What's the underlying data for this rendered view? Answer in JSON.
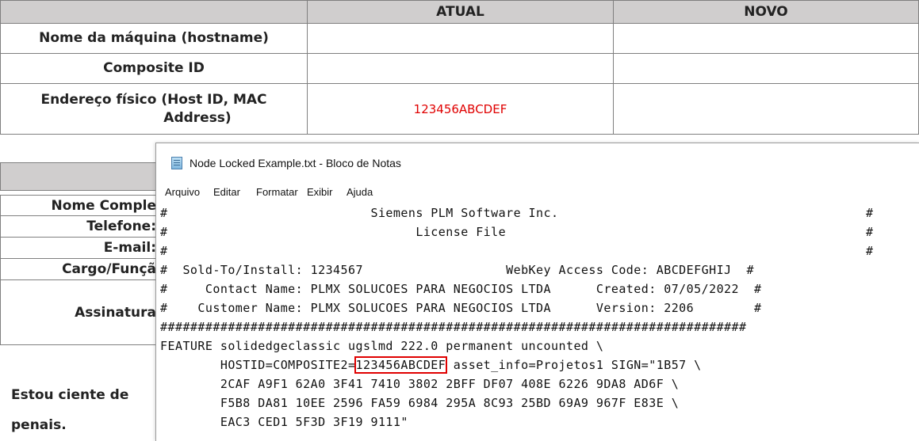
{
  "top_table": {
    "headers": [
      "",
      "ATUAL",
      "NOVO"
    ],
    "rows": [
      {
        "label": "Nome da máquina (hostname)",
        "atual": "",
        "novo": ""
      },
      {
        "label": "Composite ID",
        "atual": "",
        "novo": ""
      },
      {
        "label_line1": "Endereço físico (Host ID, MAC",
        "label_line2": "Address)",
        "atual": "123456ABCDEF",
        "novo": ""
      }
    ]
  },
  "bg_table": {
    "labels": [
      "Nome Comple",
      "Telefone:",
      "E-mail:",
      "Cargo/Funçã",
      "Assinatura"
    ]
  },
  "declaration": {
    "line1": "Estou ciente de",
    "line2": "penais."
  },
  "notepad": {
    "title": "Node Locked Example.txt - Bloco de Notas",
    "menu": [
      "Arquivo",
      "Editar",
      "Formatar",
      "Exibir",
      "Ajuda"
    ],
    "lines": [
      "#                           Siemens PLM Software Inc.",
      "#                                 License File",
      "#",
      "#  Sold-To/Install: 1234567                   WebKey Access Code: ABCDEFGHIJ  #",
      "#     Contact Name: PLMX SOLUCOES PARA NEGOCIOS LTDA      Created: 07/05/2022  #",
      "#    Customer Name: PLMX SOLUCOES PARA NEGOCIOS LTDA      Version: 2206        #",
      "##############################################################################",
      "FEATURE solidedgeclassic ugslmd 222.0 permanent uncounted \\"
    ],
    "right_hash": "#",
    "hostid_prefix": "        HOSTID=COMPOSITE2=",
    "hostid_value": "123456ABCDEF",
    "hostid_suffix": " asset_info=Projetos1 SIGN=\"1B57 \\",
    "sign_lines": [
      "        2CAF A9F1 62A0 3F41 7410 3802 2BFF DF07 408E 6226 9DA8 AD6F \\",
      "        F5B8 DA81 10EE 2596 FA59 6984 295A 8C93 25BD 69A9 967F E83E \\",
      "        EAC3 CED1 5F3D 3F19 9111\""
    ]
  }
}
